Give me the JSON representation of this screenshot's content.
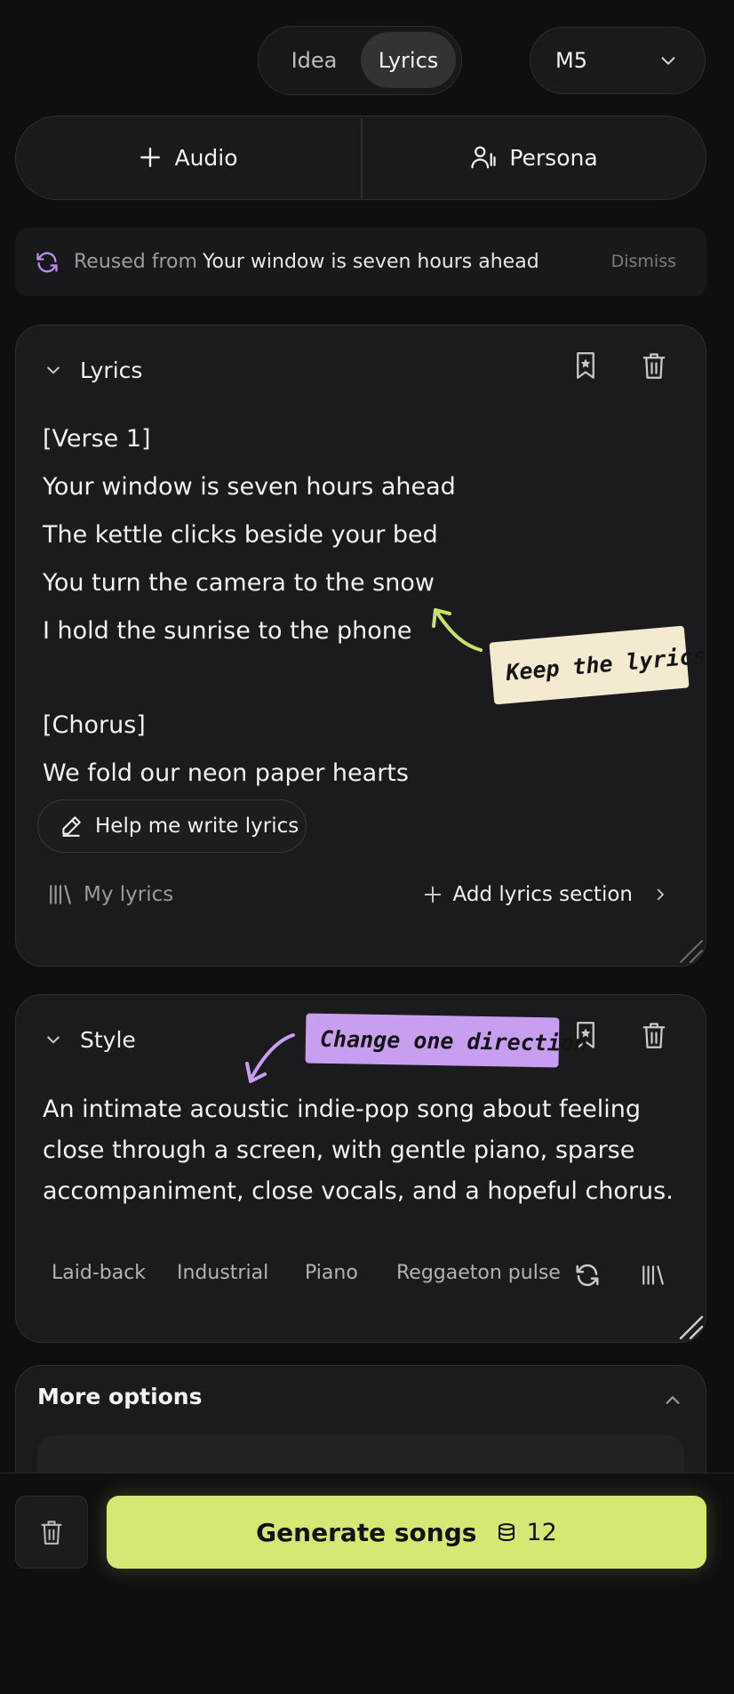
{
  "mode_toggle": {
    "idea": "Idea",
    "lyrics": "Lyrics",
    "selected": "Lyrics"
  },
  "model": {
    "value": "M5"
  },
  "source": {
    "audio": "Audio",
    "persona": "Persona"
  },
  "reuse_banner": {
    "prefix": "Reused from",
    "title": "Your window is seven hours ahead",
    "dismiss": "Dismiss"
  },
  "lyrics_card": {
    "title": "Lyrics",
    "lines": [
      "[Verse 1]",
      "Your window is seven hours ahead",
      "The kettle clicks beside your bed",
      "You turn the camera to the snow",
      "I hold the sunrise to the phone",
      "",
      "[Chorus]",
      "We fold our neon paper hearts"
    ],
    "help_button": "Help me write lyrics",
    "my_lyrics": "My lyrics",
    "add_section": "Add lyrics section"
  },
  "notes": {
    "keep": "Keep the lyrics",
    "change": "Change one direction"
  },
  "style_card": {
    "title": "Style",
    "description": "An intimate acoustic indie-pop song about feeling close through a screen, with gentle piano, sparse accompaniment, close vocals, and a hopeful chorus.",
    "tags": [
      "Laid-back",
      "Industrial",
      "Piano",
      "Reggaeton pulse"
    ]
  },
  "more_options": {
    "title": "More options"
  },
  "generate": {
    "label": "Generate songs",
    "credits": "12"
  },
  "colors": {
    "accent": "#d6e874",
    "note_keep": "#f4ead2",
    "note_change": "#c89ff0",
    "background": "#0f0f10"
  }
}
